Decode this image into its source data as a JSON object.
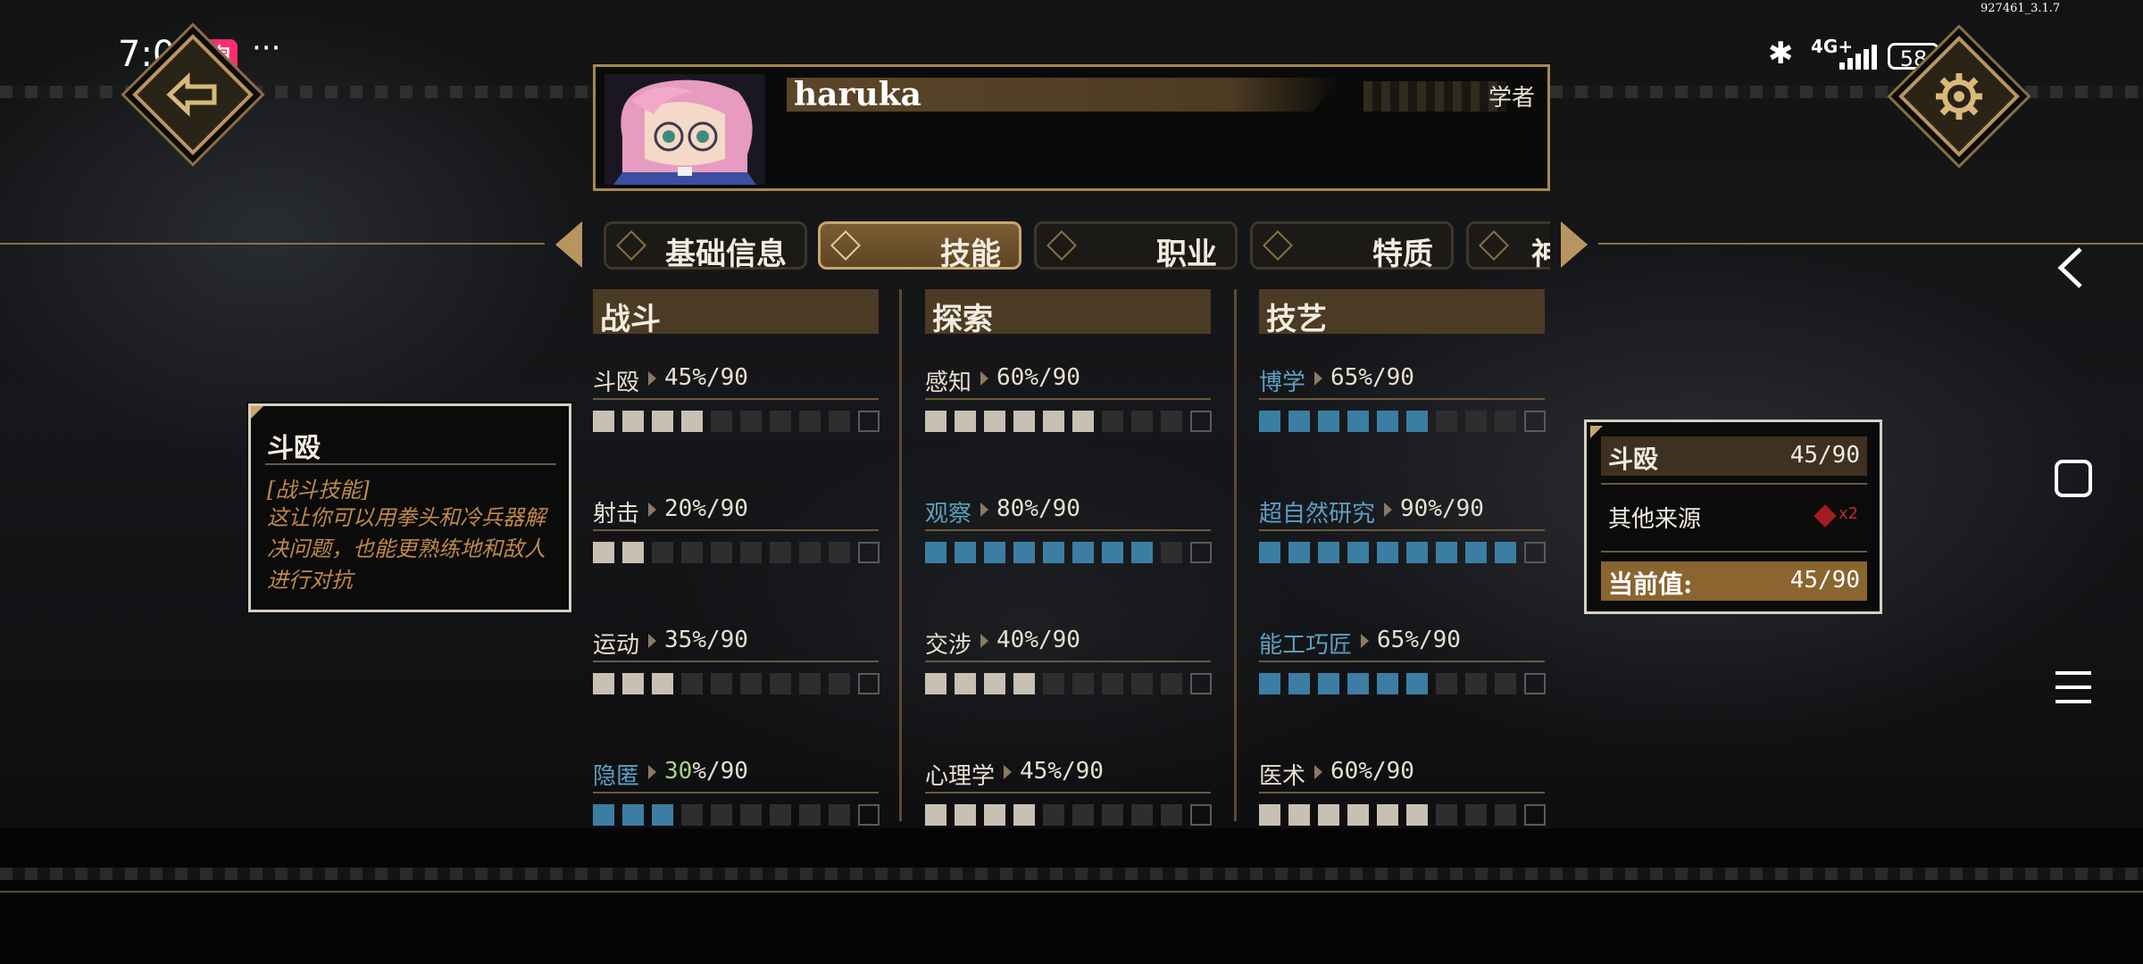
{
  "status_bar": {
    "time": "7:07",
    "app_badge": "淘",
    "more": "···",
    "build_id": "927461_3.1.7",
    "network": "4G+",
    "battery": "58"
  },
  "character": {
    "name": "haruka",
    "class": "学者"
  },
  "tabs": [
    {
      "label": "基础信息",
      "active": false
    },
    {
      "label": "技能",
      "active": true
    },
    {
      "label": "职业",
      "active": false
    },
    {
      "label": "特质",
      "active": false
    },
    {
      "label": "神",
      "active": false
    }
  ],
  "columns": [
    {
      "title": "战斗",
      "skills": [
        {
          "name": "斗殴",
          "value": "45",
          "max": "90",
          "filled": 4,
          "color": "grey",
          "name_color": "normal"
        },
        {
          "name": "射击",
          "value": "20",
          "max": "90",
          "filled": 2,
          "color": "grey",
          "name_color": "normal"
        },
        {
          "name": "运动",
          "value": "35",
          "max": "90",
          "filled": 3,
          "color": "grey",
          "name_color": "normal"
        },
        {
          "name": "隐匿",
          "value": "30",
          "max": "90",
          "filled": 3,
          "color": "blue",
          "name_color": "blue",
          "value_highlight": true
        }
      ]
    },
    {
      "title": "探索",
      "skills": [
        {
          "name": "感知",
          "value": "60",
          "max": "90",
          "filled": 6,
          "color": "grey",
          "name_color": "normal"
        },
        {
          "name": "观察",
          "value": "80",
          "max": "90",
          "filled": 8,
          "color": "blue",
          "name_color": "blue"
        },
        {
          "name": "交涉",
          "value": "40",
          "max": "90",
          "filled": 4,
          "color": "grey",
          "name_color": "normal"
        },
        {
          "name": "心理学",
          "value": "45",
          "max": "90",
          "filled": 4,
          "color": "grey",
          "name_color": "normal"
        }
      ]
    },
    {
      "title": "技艺",
      "skills": [
        {
          "name": "博学",
          "value": "65",
          "max": "90",
          "filled": 6,
          "color": "blue",
          "name_color": "blue"
        },
        {
          "name": "超自然研究",
          "value": "90",
          "max": "90",
          "filled": 9,
          "color": "blue",
          "name_color": "blue"
        },
        {
          "name": "能工巧匠",
          "value": "65",
          "max": "90",
          "filled": 6,
          "color": "blue",
          "name_color": "blue"
        },
        {
          "name": "医术",
          "value": "60",
          "max": "90",
          "filled": 6,
          "color": "grey",
          "name_color": "normal"
        }
      ]
    }
  ],
  "tooltip": {
    "title": "斗殴",
    "tag": "[战斗技能]",
    "body": "这让你可以用拳头和冷兵器解决问题，也能更熟练地和敌人进行对抗"
  },
  "breakdown": {
    "skill_name": "斗殴",
    "skill_value": "45/90",
    "source_label": "其他来源",
    "source_mult": "x2",
    "current_label": "当前值:",
    "current_value": "45/90"
  },
  "colors": {
    "gold": "#b89560",
    "pip_blue": "#3c7ea3",
    "pip_grey": "#c7c0b3",
    "skill_blue_text": "#5d9fc1",
    "tooltip_text": "#c0894a"
  }
}
